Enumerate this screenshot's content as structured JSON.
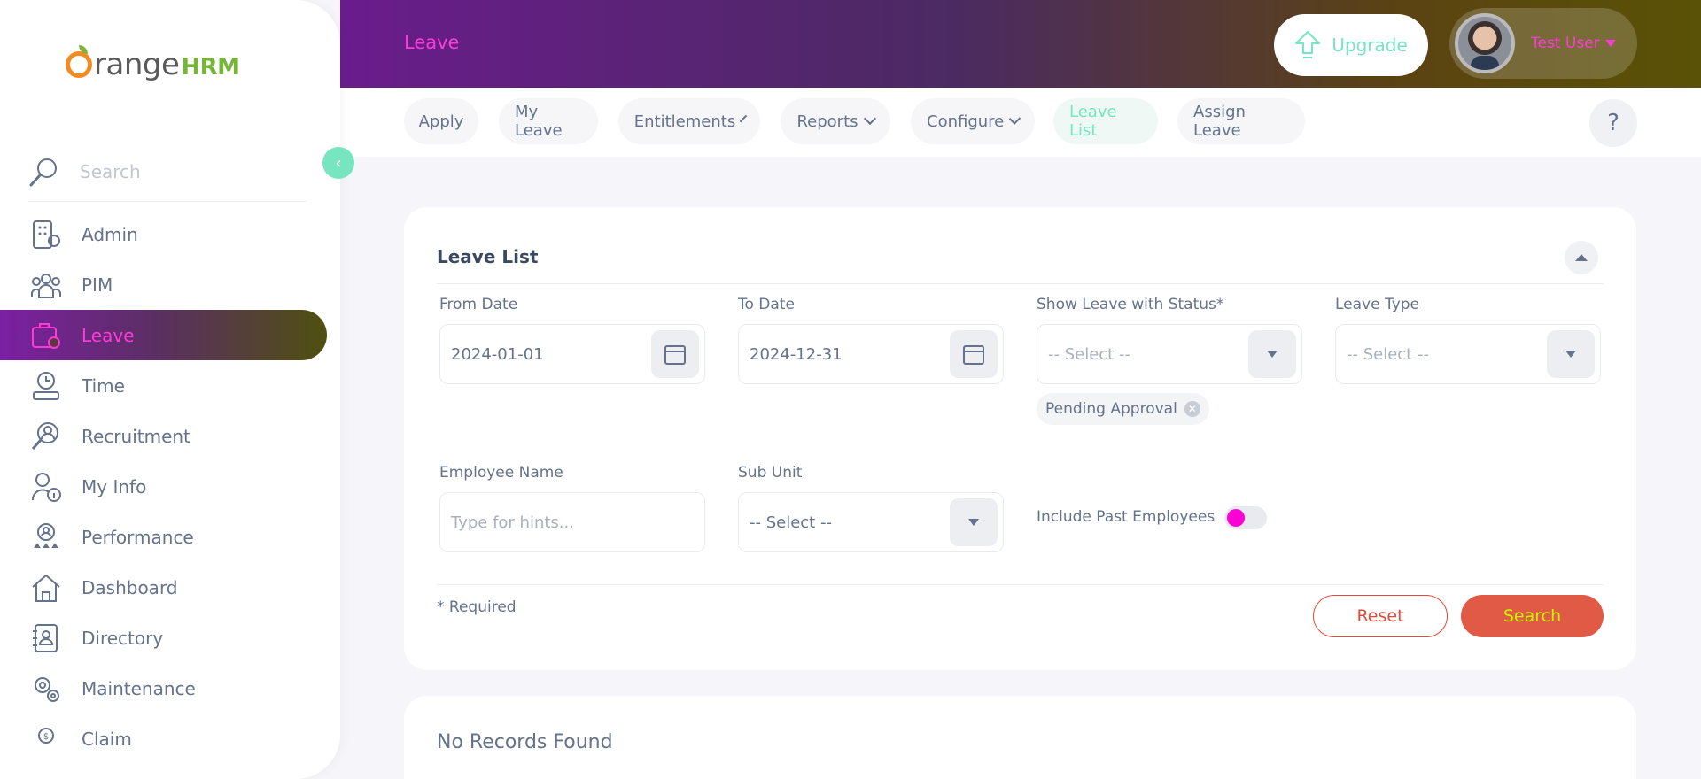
{
  "brand": {
    "name_part1": "range",
    "name_part2": "HRM"
  },
  "sidebar": {
    "search_placeholder": "Search",
    "collapse_glyph": "‹",
    "items": [
      {
        "label": "Admin",
        "icon": "admin-icon"
      },
      {
        "label": "PIM",
        "icon": "pim-icon"
      },
      {
        "label": "Leave",
        "icon": "leave-icon",
        "active": true
      },
      {
        "label": "Time",
        "icon": "time-icon"
      },
      {
        "label": "Recruitment",
        "icon": "recruitment-icon"
      },
      {
        "label": "My Info",
        "icon": "my-info-icon"
      },
      {
        "label": "Performance",
        "icon": "performance-icon"
      },
      {
        "label": "Dashboard",
        "icon": "dashboard-icon"
      },
      {
        "label": "Directory",
        "icon": "directory-icon"
      },
      {
        "label": "Maintenance",
        "icon": "maintenance-icon"
      },
      {
        "label": "Claim",
        "icon": "claim-icon"
      }
    ]
  },
  "topbar": {
    "title": "Leave",
    "upgrade_label": "Upgrade",
    "user_name": "Test User"
  },
  "subnav": {
    "tabs": [
      {
        "label": "Apply"
      },
      {
        "label": "My Leave"
      },
      {
        "label": "Entitlements"
      },
      {
        "label": "Reports"
      },
      {
        "label": "Configure"
      },
      {
        "label": "Leave List",
        "active": true
      },
      {
        "label": "Assign Leave"
      }
    ],
    "help_glyph": "?"
  },
  "filter": {
    "title": "Leave List",
    "from_date_label": "From Date",
    "from_date_value": "2024-01-01",
    "to_date_label": "To Date",
    "to_date_value": "2024-12-31",
    "status_label": "Show Leave with Status*",
    "status_placeholder": "-- Select --",
    "status_chip": "Pending Approval",
    "leave_type_label": "Leave Type",
    "leave_type_placeholder": "-- Select --",
    "employee_label": "Employee Name",
    "employee_placeholder": "Type for hints...",
    "subunit_label": "Sub Unit",
    "subunit_placeholder": "-- Select --",
    "past_employees_label": "Include Past Employees",
    "required_note": "* Required",
    "reset_label": "Reset",
    "search_label": "Search"
  },
  "results": {
    "message": "No Records Found"
  },
  "colors": {
    "accent_green": "#76e5c0",
    "accent_pink": "#ff3ad6",
    "reset_red": "#e04a3b",
    "search_bg": "#e05a45",
    "search_text": "#c9f500"
  }
}
